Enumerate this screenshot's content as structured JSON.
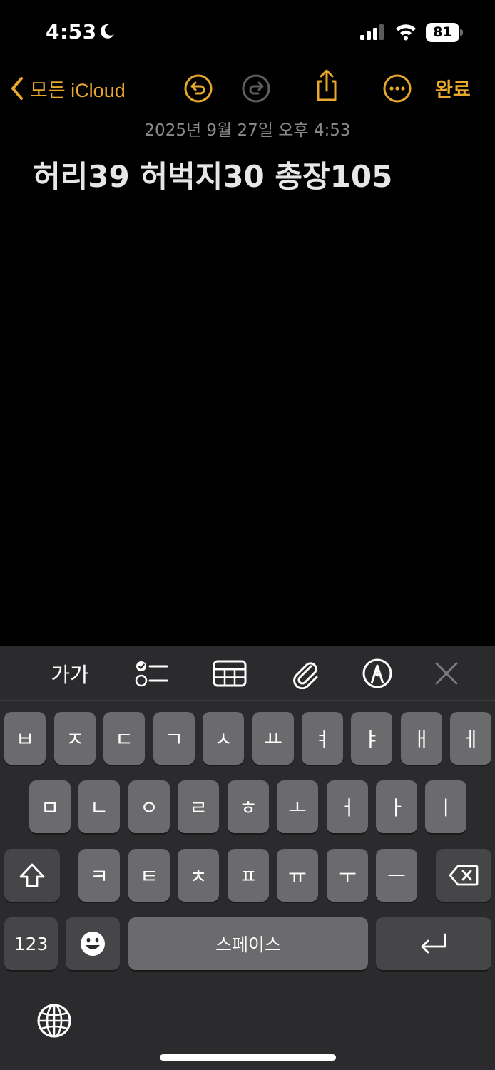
{
  "status_bar": {
    "time": "4:53",
    "battery": "81",
    "icons": [
      "moon-icon",
      "cellular-signal-icon",
      "wifi-icon",
      "battery-icon"
    ]
  },
  "nav": {
    "back_label": "모든 iCloud",
    "done_label": "완료",
    "accent_color": "#e8a82e",
    "icons": [
      "chevron-left-icon",
      "undo-icon",
      "redo-icon",
      "share-icon",
      "more-icon"
    ]
  },
  "note": {
    "date": "2025년 9월 27일 오후 4:53",
    "text": "허리39 허벅지30 총장105"
  },
  "keyboard": {
    "toolbar": {
      "format_label": "가가",
      "icons": [
        "checklist-icon",
        "table-icon",
        "paperclip-icon",
        "markup-pen-icon",
        "close-icon"
      ]
    },
    "rows": [
      [
        "ㅂ",
        "ㅈ",
        "ㄷ",
        "ㄱ",
        "ㅅ",
        "ㅛ",
        "ㅕ",
        "ㅑ",
        "ㅐ",
        "ㅔ"
      ],
      [
        "ㅁ",
        "ㄴ",
        "ㅇ",
        "ㄹ",
        "ㅎ",
        "ㅗ",
        "ㅓ",
        "ㅏ",
        "ㅣ"
      ],
      [
        "ㅋ",
        "ㅌ",
        "ㅊ",
        "ㅍ",
        "ㅠ",
        "ㅜ",
        "ㅡ"
      ]
    ],
    "numbers_label": "123",
    "space_label": "스페이스",
    "special_icons": [
      "shift-icon",
      "backspace-icon",
      "emoji-icon",
      "return-icon",
      "globe-icon"
    ]
  }
}
